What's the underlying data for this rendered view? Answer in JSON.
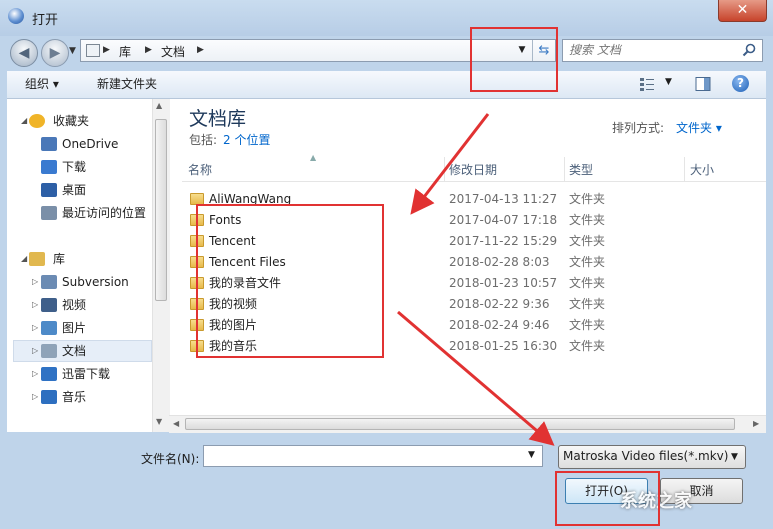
{
  "window": {
    "title": "打开",
    "close": "✕"
  },
  "address": {
    "crumbs": [
      "库",
      "文档"
    ],
    "search_placeholder": "搜索 文档"
  },
  "toolbar": {
    "organize": "组织 ▾",
    "new_folder": "新建文件夹"
  },
  "nav_tree": [
    {
      "label": "收藏夹",
      "arrow": "◢",
      "icon": "star-icon"
    },
    {
      "label": "OneDrive",
      "arrow": "",
      "icon": "onedrive-icon"
    },
    {
      "label": "下载",
      "arrow": "",
      "icon": "download-icon"
    },
    {
      "label": "桌面",
      "arrow": "",
      "icon": "desktop-icon"
    },
    {
      "label": "最近访问的位置",
      "arrow": "",
      "icon": "recent-places-icon"
    },
    {
      "label": "库",
      "arrow": "◢",
      "icon": "library-icon"
    },
    {
      "label": "Subversion",
      "arrow": "▷",
      "icon": "subversion-icon"
    },
    {
      "label": "视频",
      "arrow": "▷",
      "icon": "video-icon"
    },
    {
      "label": "图片",
      "arrow": "▷",
      "icon": "picture-icon"
    },
    {
      "label": "文档",
      "arrow": "▷",
      "icon": "document-icon"
    },
    {
      "label": "迅雷下载",
      "arrow": "▷",
      "icon": "thunder-icon"
    },
    {
      "label": "音乐",
      "arrow": "▷",
      "icon": "music-icon"
    }
  ],
  "library": {
    "title": "文档库",
    "includes": "包括:",
    "count": "2 个位置",
    "arrange_label": "排列方式:",
    "arrange_value": "文件夹 ▾"
  },
  "columns": [
    "名称",
    "修改日期",
    "类型",
    "大小"
  ],
  "files": [
    {
      "name": "AliWangWang",
      "date": "2017-04-13 11:27",
      "type": "文件夹"
    },
    {
      "name": "Fonts",
      "date": "2017-04-07 17:18",
      "type": "文件夹"
    },
    {
      "name": "Tencent",
      "date": "2017-11-22 15:29",
      "type": "文件夹"
    },
    {
      "name": "Tencent Files",
      "date": "2018-02-28 8:03",
      "type": "文件夹"
    },
    {
      "name": "我的录音文件",
      "date": "2018-01-23 10:57",
      "type": "文件夹"
    },
    {
      "name": "我的视频",
      "date": "2018-02-22 9:36",
      "type": "文件夹"
    },
    {
      "name": "我的图片",
      "date": "2018-02-24 9:46",
      "type": "文件夹"
    },
    {
      "name": "我的音乐",
      "date": "2018-01-25 16:30",
      "type": "文件夹"
    }
  ],
  "bottom": {
    "filename_label": "文件名(N):",
    "filename_value": "",
    "filetype": "Matroska Video files(*.mkv)",
    "open": "打开(O)",
    "cancel": "取消"
  },
  "watermark": "系统之家",
  "colors": {
    "annotation": "#e13232",
    "accent": "#0066cc"
  }
}
